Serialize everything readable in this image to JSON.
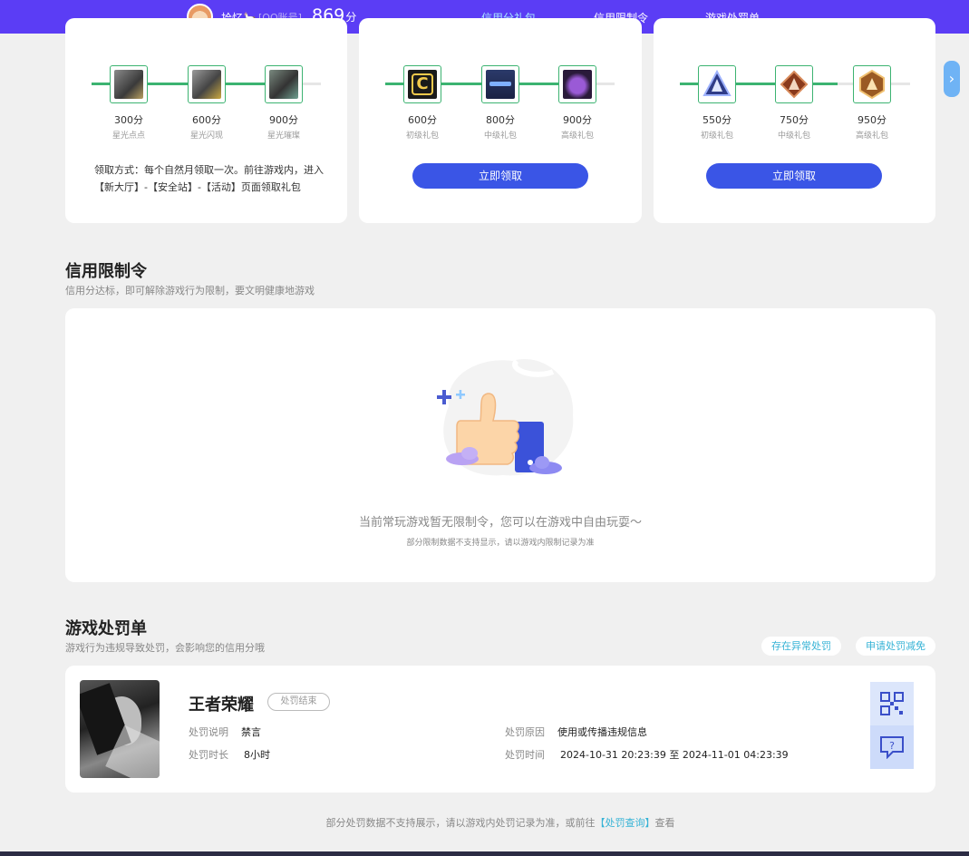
{
  "header": {
    "username": "拾忆🦙",
    "account_type": "[QQ账号]",
    "score": "869",
    "score_unit": "分",
    "tabs": [
      {
        "label": "信用分礼包",
        "active": true
      },
      {
        "label": "信用限制令",
        "active": false
      },
      {
        "label": "游戏处罚单",
        "active": false
      }
    ]
  },
  "gift_cards": [
    {
      "rewards": [
        {
          "points": "300分",
          "name": "星光点点"
        },
        {
          "points": "600分",
          "name": "星光闪现"
        },
        {
          "points": "900分",
          "name": "星光璀璨"
        }
      ],
      "claim_method": "领取方式：每个自然月领取一次。前往游戏内，进入【新大厅】-【安全站】-【活动】页面领取礼包"
    },
    {
      "rewards": [
        {
          "points": "600分",
          "name": "初级礼包"
        },
        {
          "points": "800分",
          "name": "中级礼包"
        },
        {
          "points": "900分",
          "name": "高级礼包"
        }
      ],
      "button": "立即领取"
    },
    {
      "rewards": [
        {
          "points": "550分",
          "name": "初级礼包"
        },
        {
          "points": "750分",
          "name": "中级礼包"
        },
        {
          "points": "950分",
          "name": "高级礼包"
        }
      ],
      "button": "立即领取"
    }
  ],
  "restriction": {
    "title": "信用限制令",
    "subtitle": "信用分达标，即可解除游戏行为限制，要文明健康地游戏",
    "empty_message": "当前常玩游戏暂无限制令，您可以在游戏中自由玩耍～",
    "empty_note": "部分限制数据不支持显示，请以游戏内限制记录为准"
  },
  "penalty": {
    "title": "游戏处罚单",
    "subtitle": "游戏行为违规导致处罚，会影响您的信用分哦",
    "btn_abnormal": "存在异常处罚",
    "btn_appeal": "申请处罚减免",
    "record": {
      "game": "王者荣耀",
      "status": "处罚结束",
      "desc_label": "处罚说明",
      "desc_value": "禁言",
      "duration_label": "处罚时长",
      "duration_value": "8小时",
      "reason_label": "处罚原因",
      "reason_value": "使用或传播违规信息",
      "time_label": "处罚时间",
      "time_value": "2024-10-31 20:23:39 至 2024-11-01 04:23:39"
    },
    "footnote_prefix": "部分处罚数据不支持展示，请以游戏内处罚记录为准，或前往",
    "footnote_link": "【处罚查询】",
    "footnote_suffix": "查看"
  },
  "colors": {
    "header_bg": "#5b3df5",
    "accent_blue": "#3a55e6",
    "track_green": "#3cb371",
    "link_cyan": "#36b3d6"
  }
}
